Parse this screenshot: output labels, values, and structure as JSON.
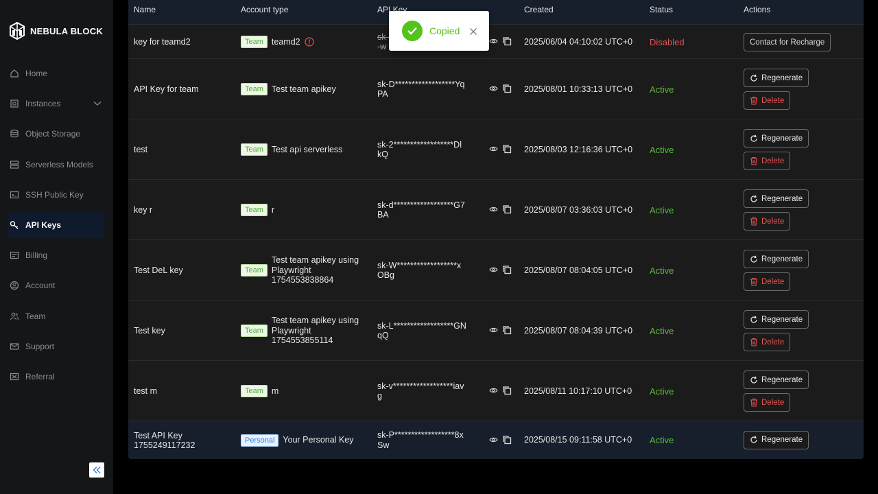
{
  "brand": {
    "name": "NEBULA BLOCK"
  },
  "sidebar": {
    "items": [
      {
        "label": "Home",
        "icon": "home-icon"
      },
      {
        "label": "Instances",
        "icon": "cpu-icon"
      },
      {
        "label": "Object Storage",
        "icon": "database-icon"
      },
      {
        "label": "Serverless Models",
        "icon": "server-icon"
      },
      {
        "label": "SSH Public Key",
        "icon": "ssh-key-icon"
      },
      {
        "label": "API Keys",
        "icon": "key-icon",
        "active": true
      },
      {
        "label": "Billing",
        "icon": "billing-icon"
      },
      {
        "label": "Account",
        "icon": "account-icon"
      },
      {
        "label": "Team",
        "icon": "team-icon"
      },
      {
        "label": "Support",
        "icon": "mail-icon"
      },
      {
        "label": "Referral",
        "icon": "referral-icon"
      }
    ]
  },
  "table": {
    "headers": {
      "name": "Name",
      "account_type": "Account type",
      "api_key": "API Key",
      "created": "Created",
      "status": "Status",
      "actions": "Actions"
    },
    "rows": [
      {
        "name": "key for teamd2",
        "badge": "Team",
        "account": "teamd2",
        "key": "sk-B******************hP\n-w",
        "created": "2025/06/04 04:10:02 UTC+0",
        "status": "Disabled",
        "action": "Contact for Recharge"
      },
      {
        "name": "API Key for team",
        "badge": "Team",
        "account": "Test team apikey",
        "key": "sk-D******************Yq\nPA",
        "created": "2025/08/01 10:33:13 UTC+0",
        "status": "Active",
        "regenerate": "Regenerate",
        "delete": "Delete"
      },
      {
        "name": "test",
        "badge": "Team",
        "account": "Test api serverless",
        "key": "sk-2******************Dl\nkQ",
        "created": "2025/08/03 12:16:36 UTC+0",
        "status": "Active",
        "regenerate": "Regenerate",
        "delete": "Delete"
      },
      {
        "name": "key r",
        "badge": "Team",
        "account": "r",
        "key": "sk-d******************G7\nBA",
        "created": "2025/08/07 03:36:03 UTC+0",
        "status": "Active",
        "regenerate": "Regenerate",
        "delete": "Delete"
      },
      {
        "name": "Test DeL key",
        "badge": "Team",
        "account": "Test team apikey using Playwright 1754553838864",
        "key": "sk-W******************x\nOBg",
        "created": "2025/08/07 08:04:05 UTC+0",
        "status": "Active",
        "regenerate": "Regenerate",
        "delete": "Delete"
      },
      {
        "name": "Test key",
        "badge": "Team",
        "account": "Test team apikey using Playwright 1754553855114",
        "key": "sk-L******************GN\nqQ",
        "created": "2025/08/07 08:04:39 UTC+0",
        "status": "Active",
        "regenerate": "Regenerate",
        "delete": "Delete"
      },
      {
        "name": "test m",
        "badge": "Team",
        "account": "m",
        "key": "sk-v******************iav\ng",
        "created": "2025/08/11 10:17:10 UTC+0",
        "status": "Active",
        "regenerate": "Regenerate",
        "delete": "Delete"
      },
      {
        "name": "Test API Key 1755249117232",
        "badge": "Personal",
        "account": "Your Personal Key",
        "key": "sk-P******************8x\nSw",
        "created": "2025/08/15 09:11:58 UTC+0",
        "status": "Active",
        "regenerate": "Regenerate"
      }
    ]
  },
  "toast": {
    "text": "Copied"
  },
  "colors": {
    "active": "#59b93b",
    "disabled": "#e55353",
    "toast_green": "#52c41a",
    "header_bg": "#161f2b"
  }
}
